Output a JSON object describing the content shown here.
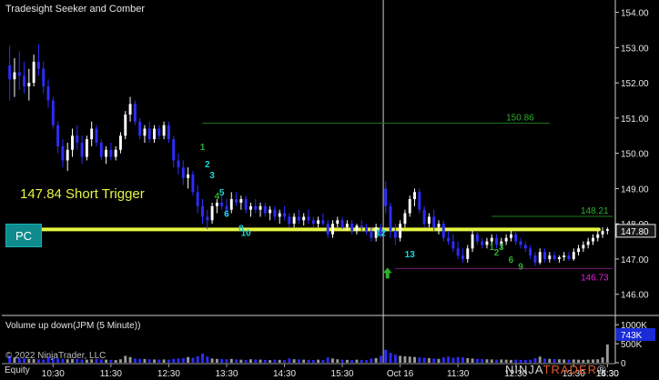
{
  "window": {
    "title": "Tradesight Seeker and Comber"
  },
  "buttons": {
    "pc_label": "PC"
  },
  "annotations": {
    "short_trigger": "147.84 Short Trigger",
    "level_upper": "150.86",
    "level_right": "148.21",
    "level_lower": "146.73",
    "current_price": "147.80",
    "volume_current": "743K"
  },
  "volume_panel": {
    "title": "Volume up down(JPM (5 Minute))"
  },
  "footer": {
    "copyright": "© 2022 NinjaTrader, LLC",
    "equity_label": "Equity"
  },
  "logo": {
    "part1": "NINJA",
    "part2": "TRADER",
    "suffix": "®"
  },
  "colors": {
    "up_candle": "#ffffff",
    "down_candle": "#2d2dff",
    "trigger_line": "#e6f542",
    "teal": "#19d7d7",
    "green": "#2eae2e",
    "magenta": "#e020e0"
  },
  "setup_counts": [
    {
      "label": "1",
      "price": 150.1,
      "color": "#2eae2e"
    },
    {
      "label": "2",
      "price": 149.6,
      "color": "#19d7d7"
    },
    {
      "label": "3",
      "price": 149.3,
      "color": "#19d7d7"
    },
    {
      "label": "4",
      "price": 148.7,
      "color": "#2eae2e"
    },
    {
      "label": "5",
      "price": 148.8,
      "color": "#19d7d7"
    },
    {
      "label": "6",
      "price": 148.2,
      "color": "#19d7d7"
    },
    {
      "label": "8",
      "price": 147.78,
      "color": "#19d7d7"
    },
    {
      "label": "10",
      "price": 147.65,
      "color": "#19d7d7"
    },
    {
      "label": "12",
      "price": 147.65,
      "color": "#19d7d7"
    },
    {
      "label": "13",
      "price": 147.05,
      "color": "#19d7d7"
    },
    {
      "label": "1",
      "price": 147.25,
      "color": "#2eae2e"
    },
    {
      "label": "2",
      "price": 147.1,
      "color": "#2eae2e"
    },
    {
      "label": "3",
      "price": 147.25,
      "color": "#2eae2e"
    },
    {
      "label": "6",
      "price": 146.9,
      "color": "#2eae2e"
    },
    {
      "label": "9",
      "price": 146.7,
      "color": "#2eae2e"
    }
  ],
  "chart_data": {
    "type": "candlestick",
    "symbol": "JPM",
    "interval": "5 Minute",
    "y_ticks": [
      "154.00",
      "153.00",
      "152.00",
      "151.00",
      "150.00",
      "149.00",
      "148.00",
      "147.00",
      "146.00"
    ],
    "y_range": [
      145.45,
      154.3
    ],
    "x_ticks": [
      "10:30",
      "11:30",
      "12:30",
      "13:30",
      "14:30",
      "15:30",
      "Oct 16",
      "11:30",
      "12:30",
      "13:30",
      "14:30",
      "15:30"
    ],
    "volume_ticks": [
      "1000K",
      "500K",
      "0"
    ],
    "volume_range": [
      0,
      1100
    ],
    "session_break_index": 78,
    "trigger_price": 147.84,
    "levels": {
      "upper": 150.86,
      "right": 148.21,
      "lower": 146.73,
      "current": 147.8
    },
    "bars": [
      [
        152.5,
        153.05,
        151.5,
        152.1
      ],
      [
        152.1,
        152.7,
        151.6,
        152.3
      ],
      [
        152.3,
        152.9,
        151.8,
        152.2
      ],
      [
        152.2,
        152.6,
        151.7,
        151.9
      ],
      [
        151.9,
        152.4,
        151.5,
        152.0
      ],
      [
        152.0,
        152.8,
        151.9,
        152.6
      ],
      [
        152.6,
        153.1,
        152.2,
        152.4
      ],
      [
        152.4,
        152.6,
        151.7,
        151.9
      ],
      [
        151.9,
        152.1,
        151.3,
        151.5
      ],
      [
        151.5,
        151.6,
        150.7,
        150.8
      ],
      [
        150.8,
        150.9,
        150.0,
        150.2
      ],
      [
        150.2,
        150.4,
        149.6,
        149.8
      ],
      [
        149.8,
        150.3,
        149.5,
        150.1
      ],
      [
        150.1,
        150.7,
        149.9,
        150.5
      ],
      [
        150.5,
        150.8,
        150.1,
        150.3
      ],
      [
        150.3,
        150.5,
        149.7,
        149.9
      ],
      [
        149.9,
        150.5,
        149.8,
        150.4
      ],
      [
        150.4,
        150.9,
        150.2,
        150.7
      ],
      [
        150.7,
        150.8,
        150.2,
        150.3
      ],
      [
        150.3,
        150.4,
        149.8,
        149.9
      ],
      [
        149.9,
        150.2,
        149.7,
        150.1
      ],
      [
        150.1,
        150.3,
        149.8,
        149.9
      ],
      [
        149.9,
        150.2,
        149.8,
        150.1
      ],
      [
        150.1,
        150.6,
        150.0,
        150.5
      ],
      [
        150.5,
        151.2,
        150.4,
        151.1
      ],
      [
        151.1,
        151.6,
        150.9,
        151.4
      ],
      [
        151.4,
        151.5,
        150.8,
        150.9
      ],
      [
        150.9,
        151.0,
        150.4,
        150.5
      ],
      [
        150.5,
        150.8,
        150.3,
        150.7
      ],
      [
        150.7,
        150.9,
        150.3,
        150.4
      ],
      [
        150.4,
        150.8,
        150.3,
        150.7
      ],
      [
        150.7,
        150.8,
        150.4,
        150.5
      ],
      [
        150.5,
        150.9,
        150.4,
        150.8
      ],
      [
        150.8,
        150.9,
        150.3,
        150.4
      ],
      [
        150.4,
        150.5,
        149.6,
        149.8
      ],
      [
        149.8,
        150.0,
        149.4,
        149.6
      ],
      [
        149.6,
        149.8,
        149.1,
        149.3
      ],
      [
        149.3,
        149.6,
        149.0,
        149.4
      ],
      [
        149.4,
        149.5,
        148.8,
        148.9
      ],
      [
        148.9,
        149.1,
        148.3,
        148.5
      ],
      [
        148.5,
        148.7,
        148.0,
        148.2
      ],
      [
        148.2,
        148.4,
        147.85,
        148.1
      ],
      [
        148.1,
        148.6,
        148.0,
        148.5
      ],
      [
        148.5,
        148.7,
        148.3,
        148.6
      ],
      [
        148.6,
        148.8,
        148.4,
        148.5
      ],
      [
        148.5,
        148.7,
        148.2,
        148.4
      ],
      [
        148.4,
        148.9,
        148.3,
        148.7
      ],
      [
        148.7,
        148.9,
        148.5,
        148.6
      ],
      [
        148.6,
        148.8,
        148.4,
        148.7
      ],
      [
        148.7,
        148.8,
        148.3,
        148.4
      ],
      [
        148.4,
        148.6,
        148.2,
        148.5
      ],
      [
        148.5,
        148.7,
        148.3,
        148.4
      ],
      [
        148.4,
        148.6,
        148.2,
        148.5
      ],
      [
        148.5,
        148.6,
        148.2,
        148.3
      ],
      [
        148.3,
        148.5,
        148.1,
        148.4
      ],
      [
        148.4,
        148.5,
        148.1,
        148.2
      ],
      [
        148.2,
        148.4,
        148.0,
        148.3
      ],
      [
        148.3,
        148.5,
        148.1,
        148.2
      ],
      [
        148.2,
        148.3,
        147.9,
        148.0
      ],
      [
        148.0,
        148.3,
        147.9,
        148.2
      ],
      [
        148.2,
        148.4,
        148.0,
        148.1
      ],
      [
        148.1,
        148.3,
        147.95,
        148.2
      ],
      [
        148.2,
        148.4,
        148.0,
        148.1
      ],
      [
        148.1,
        148.2,
        147.9,
        148.0
      ],
      [
        148.0,
        148.2,
        147.9,
        148.1
      ],
      [
        148.1,
        148.3,
        147.95,
        148.0
      ],
      [
        148.0,
        148.1,
        147.6,
        147.7
      ],
      [
        147.7,
        148.1,
        147.6,
        148.0
      ],
      [
        148.0,
        148.2,
        147.9,
        148.1
      ],
      [
        148.1,
        148.2,
        147.85,
        147.9
      ],
      [
        147.9,
        148.1,
        147.8,
        148.0
      ],
      [
        148.0,
        148.1,
        147.7,
        147.8
      ],
      [
        147.8,
        148.0,
        147.7,
        147.95
      ],
      [
        147.95,
        148.1,
        147.8,
        147.9
      ],
      [
        147.9,
        148.0,
        147.7,
        147.8
      ],
      [
        147.8,
        147.9,
        147.5,
        147.6
      ],
      [
        147.6,
        148.0,
        147.5,
        147.9
      ],
      [
        147.9,
        148.0,
        147.6,
        147.7
      ],
      [
        149.0,
        149.2,
        148.3,
        148.5
      ],
      [
        148.5,
        148.6,
        147.6,
        147.8
      ],
      [
        147.8,
        148.0,
        147.4,
        147.6
      ],
      [
        147.6,
        148.1,
        147.5,
        148.0
      ],
      [
        148.0,
        148.4,
        147.9,
        148.3
      ],
      [
        148.3,
        148.8,
        148.2,
        148.7
      ],
      [
        148.7,
        149.0,
        148.5,
        148.9
      ],
      [
        148.9,
        149.0,
        148.3,
        148.4
      ],
      [
        148.4,
        148.5,
        147.9,
        148.0
      ],
      [
        148.0,
        148.3,
        147.9,
        148.2
      ],
      [
        148.2,
        148.4,
        147.8,
        147.9
      ],
      [
        147.9,
        148.1,
        147.7,
        148.0
      ],
      [
        148.0,
        148.1,
        147.5,
        147.6
      ],
      [
        147.6,
        147.8,
        147.4,
        147.5
      ],
      [
        147.5,
        147.7,
        147.2,
        147.3
      ],
      [
        147.3,
        147.5,
        147.0,
        147.1
      ],
      [
        147.1,
        147.3,
        146.9,
        147.0
      ],
      [
        147.0,
        147.4,
        146.9,
        147.3
      ],
      [
        147.3,
        147.8,
        147.2,
        147.7
      ],
      [
        147.7,
        147.8,
        147.4,
        147.5
      ],
      [
        147.5,
        147.6,
        147.3,
        147.4
      ],
      [
        147.4,
        147.6,
        147.3,
        147.5
      ],
      [
        147.5,
        147.7,
        147.4,
        147.6
      ],
      [
        147.6,
        147.7,
        147.3,
        147.4
      ],
      [
        147.4,
        147.6,
        147.3,
        147.5
      ],
      [
        147.5,
        147.7,
        147.4,
        147.6
      ],
      [
        147.6,
        147.8,
        147.5,
        147.7
      ],
      [
        147.7,
        147.8,
        147.4,
        147.5
      ],
      [
        147.5,
        147.6,
        147.3,
        147.4
      ],
      [
        147.4,
        147.5,
        147.2,
        147.3
      ],
      [
        147.3,
        147.4,
        147.0,
        147.1
      ],
      [
        147.1,
        147.2,
        146.8,
        146.9
      ],
      [
        146.9,
        147.3,
        146.85,
        147.2
      ],
      [
        147.2,
        147.3,
        146.9,
        147.0
      ],
      [
        147.0,
        147.2,
        146.9,
        147.1
      ],
      [
        147.1,
        147.2,
        146.95,
        147.0
      ],
      [
        147.0,
        147.1,
        146.9,
        147.05
      ],
      [
        147.05,
        147.2,
        146.95,
        147.1
      ],
      [
        147.1,
        147.2,
        146.95,
        147.0
      ],
      [
        147.0,
        147.3,
        146.95,
        147.2
      ],
      [
        147.2,
        147.4,
        147.1,
        147.3
      ],
      [
        147.3,
        147.5,
        147.2,
        147.4
      ],
      [
        147.4,
        147.6,
        147.3,
        147.5
      ],
      [
        147.5,
        147.7,
        147.4,
        147.6
      ],
      [
        147.6,
        147.8,
        147.5,
        147.7
      ],
      [
        147.7,
        147.9,
        147.6,
        147.8
      ],
      [
        147.8,
        147.9,
        147.7,
        147.85
      ]
    ],
    "volumes": [
      180,
      140,
      120,
      110,
      100,
      95,
      90,
      85,
      160,
      120,
      110,
      100,
      90,
      95,
      100,
      85,
      80,
      90,
      95,
      85,
      80,
      75,
      70,
      90,
      180,
      150,
      110,
      100,
      95,
      90,
      85,
      80,
      85,
      80,
      100,
      110,
      120,
      150,
      130,
      170,
      240,
      160,
      110,
      100,
      95,
      90,
      100,
      85,
      80,
      75,
      90,
      85,
      80,
      75,
      70,
      80,
      75,
      70,
      110,
      90,
      85,
      80,
      75,
      70,
      80,
      75,
      140,
      110,
      90,
      80,
      75,
      70,
      80,
      75,
      70,
      110,
      120,
      180,
      340,
      260,
      210,
      180,
      170,
      160,
      150,
      140,
      130,
      120,
      110,
      100,
      140,
      160,
      130,
      150,
      140,
      120,
      110,
      100,
      95,
      90,
      85,
      80,
      85,
      80,
      75,
      80,
      75,
      70,
      80,
      120,
      160,
      110,
      100,
      95,
      90,
      85,
      80,
      85,
      80,
      75,
      80,
      85,
      90,
      140,
      480
    ]
  }
}
